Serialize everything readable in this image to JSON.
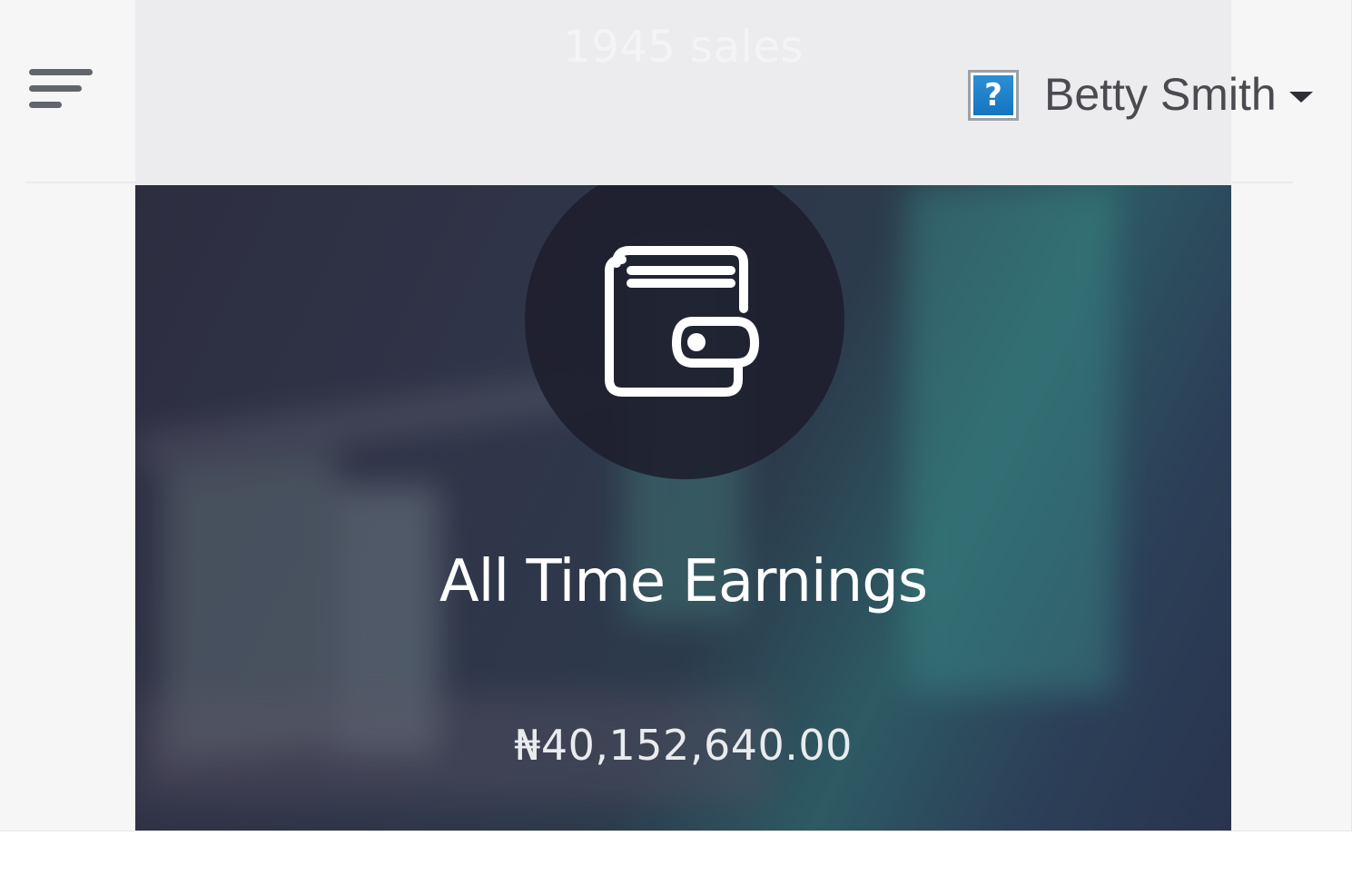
{
  "header": {
    "sales_label": "1945 sales",
    "help_label": "?",
    "user_name": "Betty Smith"
  },
  "earnings": {
    "title": "All Time Earnings",
    "amount": "₦40,152,640.00"
  },
  "colors": {
    "help_button": "#1f82cc",
    "user_text": "#4a4b50",
    "card_dark": "#2d2d40",
    "card_teal": "#2d5a63"
  }
}
